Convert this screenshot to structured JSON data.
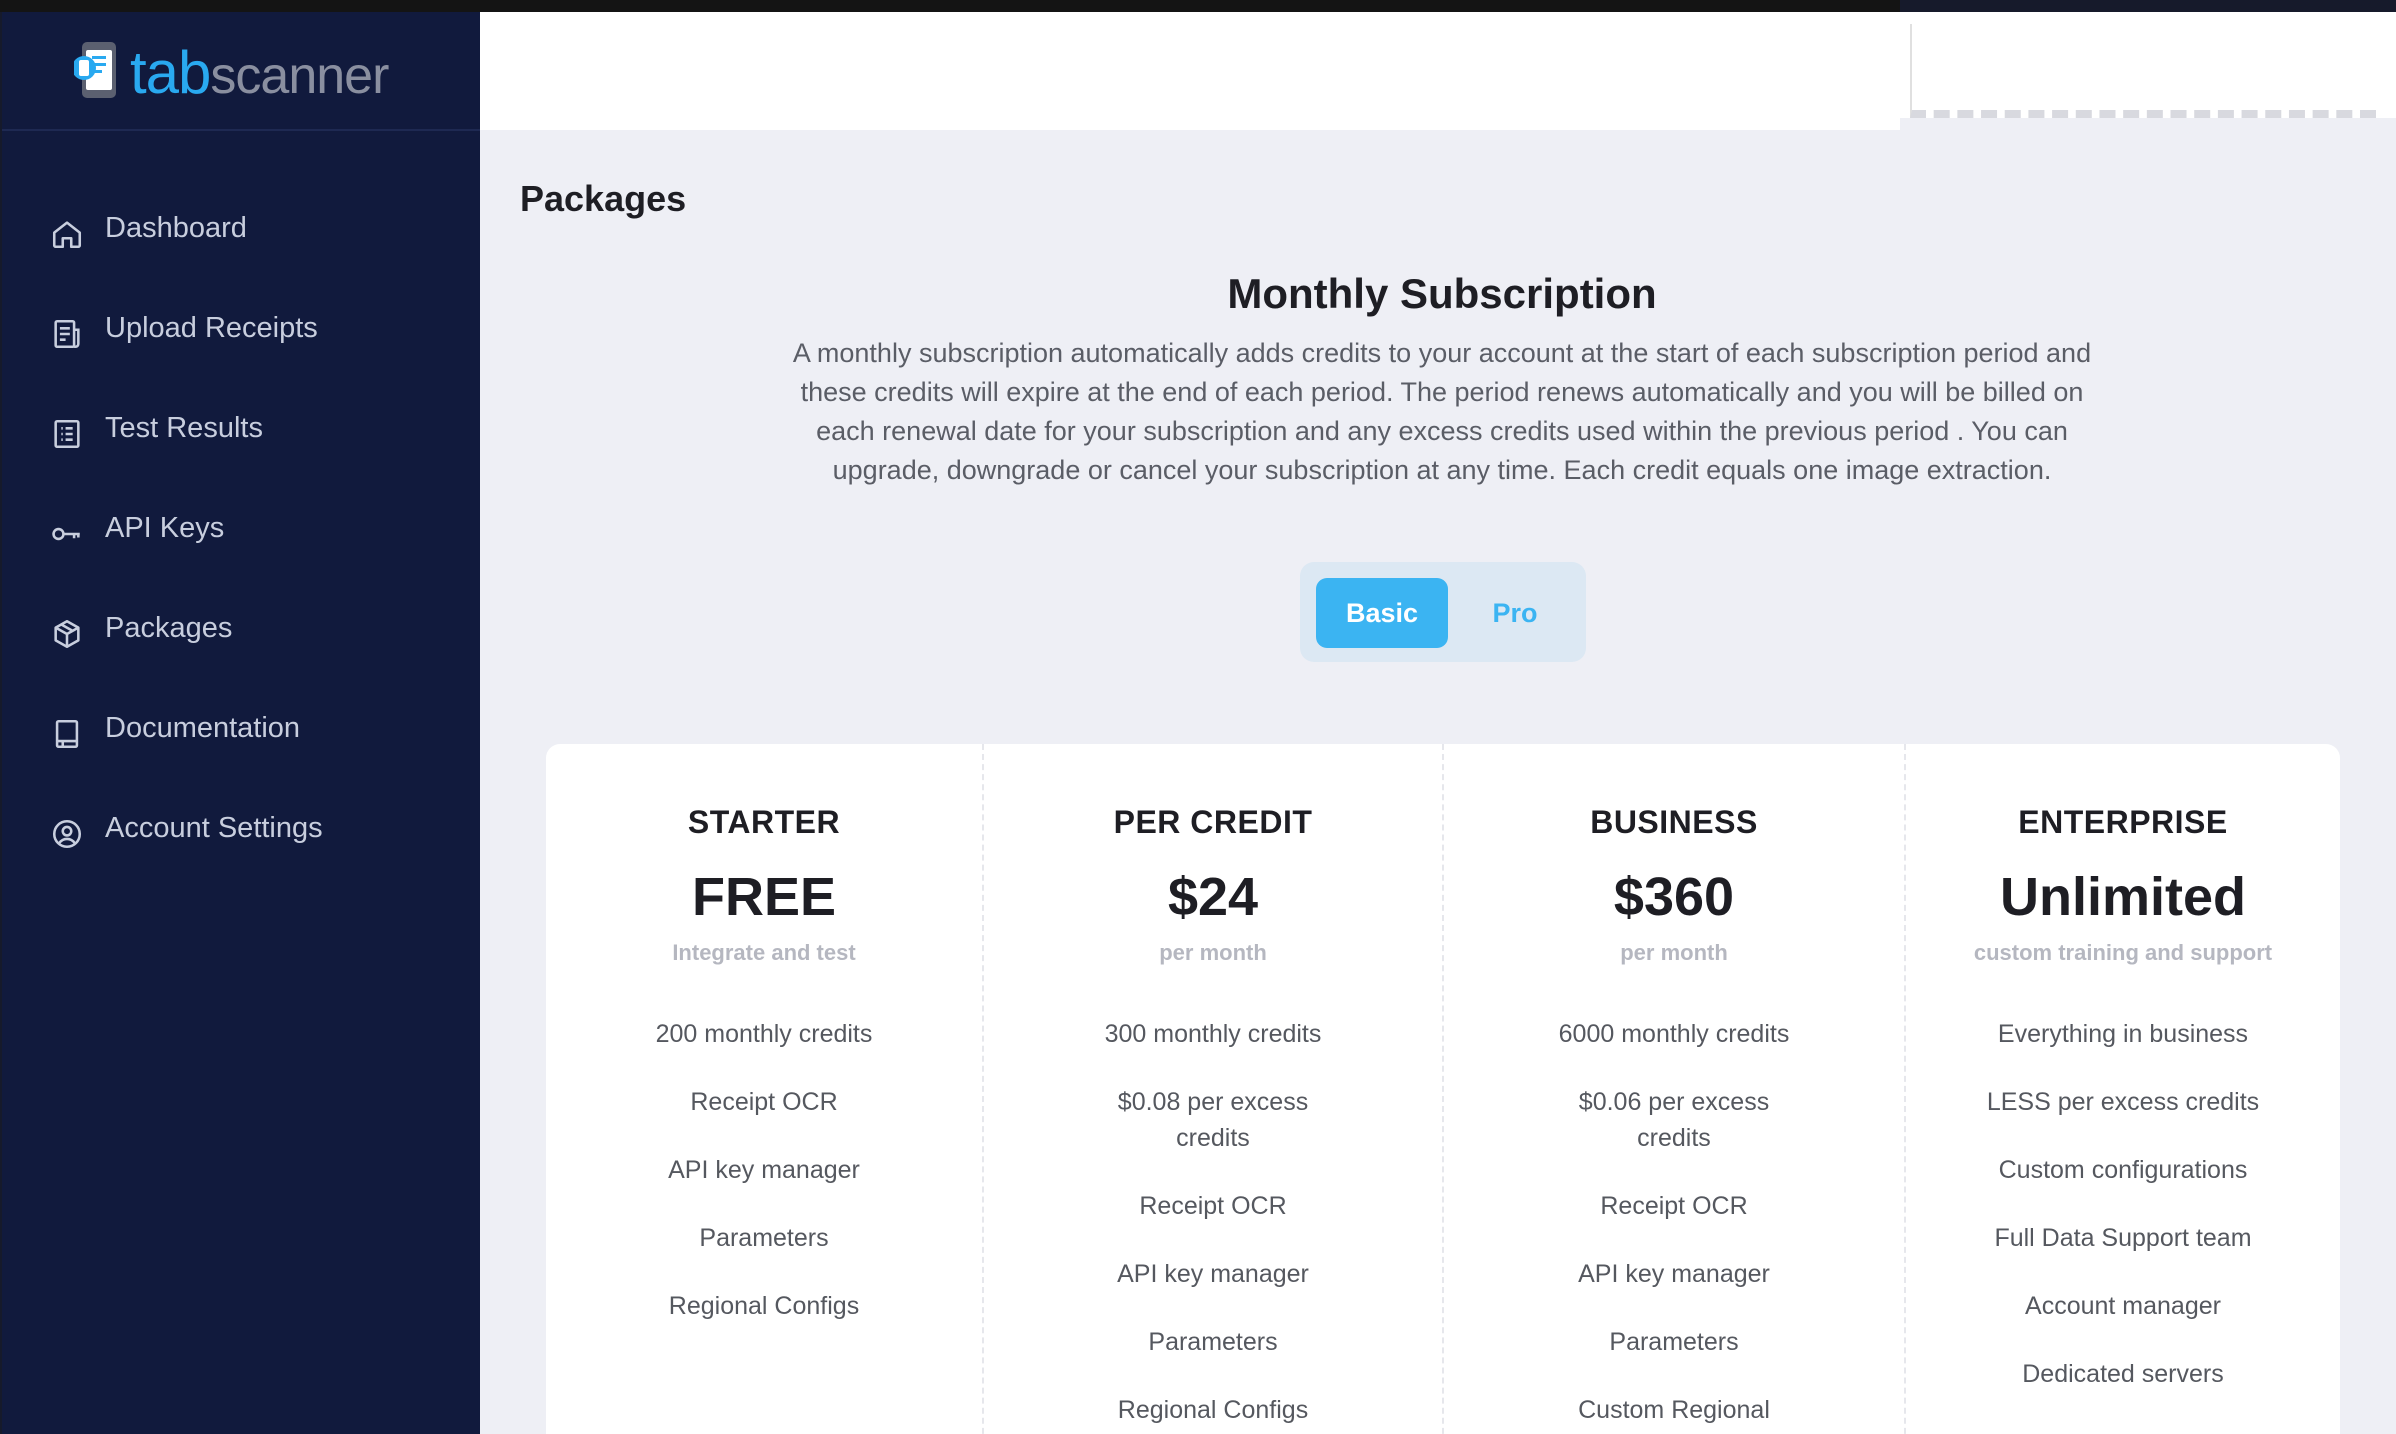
{
  "brand": {
    "tab": "tab",
    "scanner": "scanner"
  },
  "nav": [
    {
      "label": "Dashboard",
      "icon": "home-icon"
    },
    {
      "label": "Upload Receipts",
      "icon": "receipt-icon"
    },
    {
      "label": "Test Results",
      "icon": "list-icon"
    },
    {
      "label": "API Keys",
      "icon": "key-icon"
    },
    {
      "label": "Packages",
      "icon": "package-icon"
    },
    {
      "label": "Documentation",
      "icon": "book-icon"
    },
    {
      "label": "Account Settings",
      "icon": "user-circle-icon"
    }
  ],
  "page": {
    "title": "Packages",
    "subtitle": "Monthly Subscription",
    "description": "A monthly subscription automatically adds credits to your account at the start of each subscription period and these credits will expire at the end of each period. The period renews automatically and you will be billed on each renewal date for your subscription and any excess credits used within the previous period . You can upgrade, downgrade or cancel your subscription at any time. Each credit equals one image extraction."
  },
  "toggle": {
    "basic": "Basic",
    "pro": "Pro",
    "selected": "Basic"
  },
  "colors": {
    "sidebar": "#111a3d",
    "accent": "#3bb4f2",
    "background": "#eeeff5"
  },
  "plans": [
    {
      "name": "STARTER",
      "price": "FREE",
      "sub": "Integrate and test",
      "features": [
        "200 monthly credits",
        "Receipt OCR",
        "API key manager",
        "Parameters",
        "Regional Configs"
      ]
    },
    {
      "name": "PER CREDIT",
      "price": "$24",
      "sub": "per month",
      "features": [
        "300 monthly credits",
        "$0.08 per excess credits",
        "Receipt OCR",
        "API key manager",
        "Parameters",
        "Regional Configs"
      ]
    },
    {
      "name": "BUSINESS",
      "price": "$360",
      "sub": "per month",
      "features": [
        "6000 monthly credits",
        "$0.06 per excess credits",
        "Receipt OCR",
        "API key manager",
        "Parameters",
        "Custom Regional"
      ]
    },
    {
      "name": "ENTERPRISE",
      "price": "Unlimited",
      "sub": "custom training and support",
      "features": [
        "Everything in business",
        "LESS per excess credits",
        "Custom configurations",
        "Full Data Support team",
        "Account manager",
        "Dedicated servers"
      ]
    }
  ]
}
